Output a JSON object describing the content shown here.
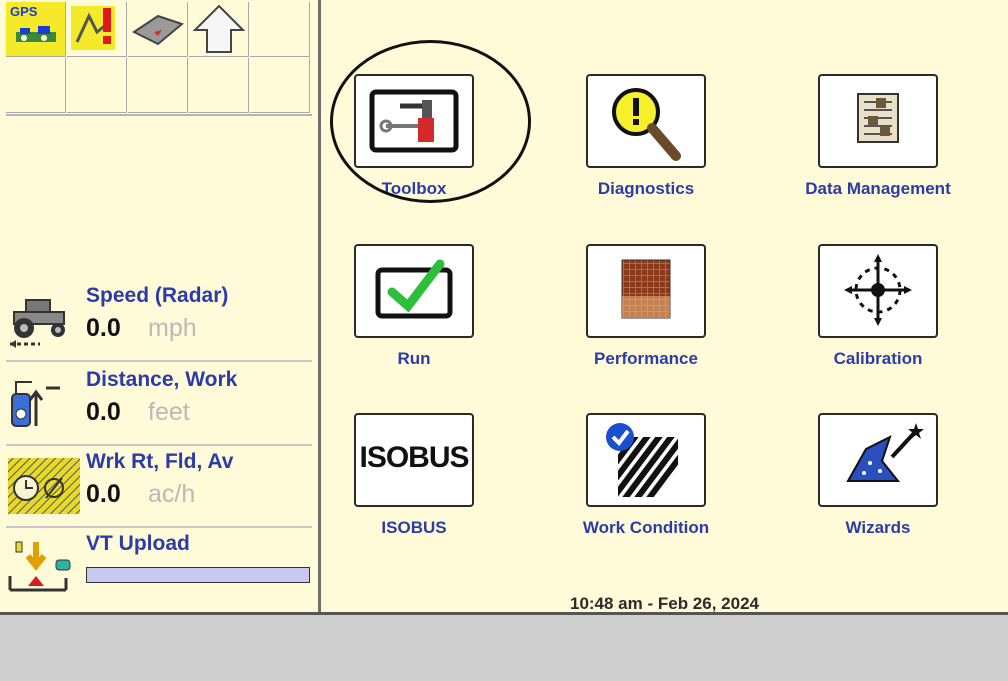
{
  "status_bar": {
    "gps_label": "GPS"
  },
  "readouts": [
    {
      "label": "Speed (Radar)",
      "value": "0.0",
      "unit": "mph",
      "icon": "tractor-speed-icon"
    },
    {
      "label": "Distance, Work",
      "value": "0.0",
      "unit": "feet",
      "icon": "distance-icon"
    },
    {
      "label": "Wrk Rt, Fld, Av",
      "value": "0.0",
      "unit": "ac/h",
      "icon": "work-rate-icon"
    }
  ],
  "vt_upload": {
    "label": "VT Upload",
    "progress": 0
  },
  "menu": {
    "items": [
      {
        "label": "Toolbox",
        "icon": "toolbox-icon"
      },
      {
        "label": "Diagnostics",
        "icon": "diagnostics-magnifier-icon"
      },
      {
        "label": "Data Management",
        "icon": "data-management-icon"
      },
      {
        "label": "Run",
        "icon": "run-checkmark-icon"
      },
      {
        "label": "Performance",
        "icon": "performance-grid-icon"
      },
      {
        "label": "Calibration",
        "icon": "calibration-crosshair-icon"
      },
      {
        "label": "ISOBUS",
        "icon": "isobus-icon",
        "icon_text": "ISOBUS"
      },
      {
        "label": "Work Condition",
        "icon": "work-condition-icon"
      },
      {
        "label": "Wizards",
        "icon": "wizard-hat-icon"
      }
    ]
  },
  "clock": "10:48 am - Feb 26, 2024",
  "colors": {
    "background": "#fffbd9",
    "label_blue": "#2b3ca8",
    "bottom_bar": "#cfcfcf"
  }
}
